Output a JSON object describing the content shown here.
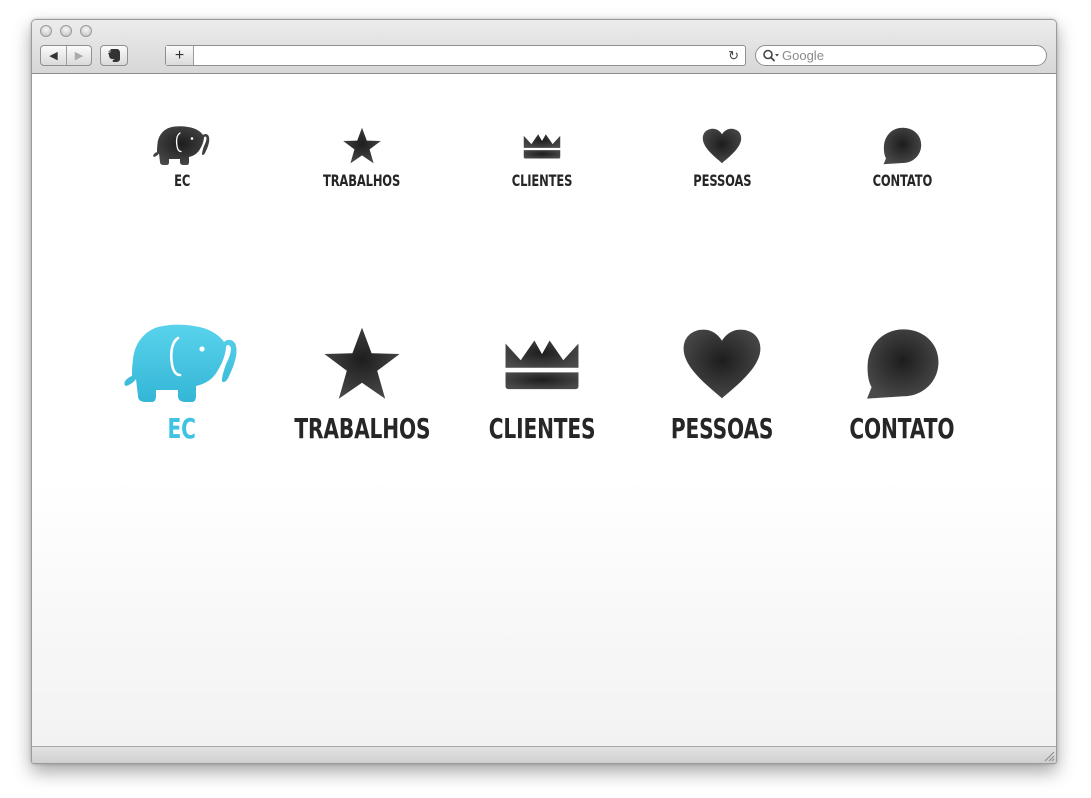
{
  "browser": {
    "search_placeholder": "Google",
    "add_label": "+",
    "back_label": "◀",
    "forward_label": "▶",
    "reload_label": "↻"
  },
  "colors": {
    "active": "#3fc3e0",
    "icon": "#262626"
  },
  "nav_small": {
    "items": [
      {
        "label": "EC",
        "icon": "elephant-icon"
      },
      {
        "label": "TRABALHOS",
        "icon": "star-icon"
      },
      {
        "label": "CLIENTES",
        "icon": "crown-icon"
      },
      {
        "label": "PESSOAS",
        "icon": "heart-icon"
      },
      {
        "label": "CONTATO",
        "icon": "speech-bubble-icon"
      }
    ]
  },
  "nav_large": {
    "active_index": 0,
    "items": [
      {
        "label": "EC",
        "icon": "elephant-icon"
      },
      {
        "label": "TRABALHOS",
        "icon": "star-icon"
      },
      {
        "label": "CLIENTES",
        "icon": "crown-icon"
      },
      {
        "label": "PESSOAS",
        "icon": "heart-icon"
      },
      {
        "label": "CONTATO",
        "icon": "speech-bubble-icon"
      }
    ]
  }
}
